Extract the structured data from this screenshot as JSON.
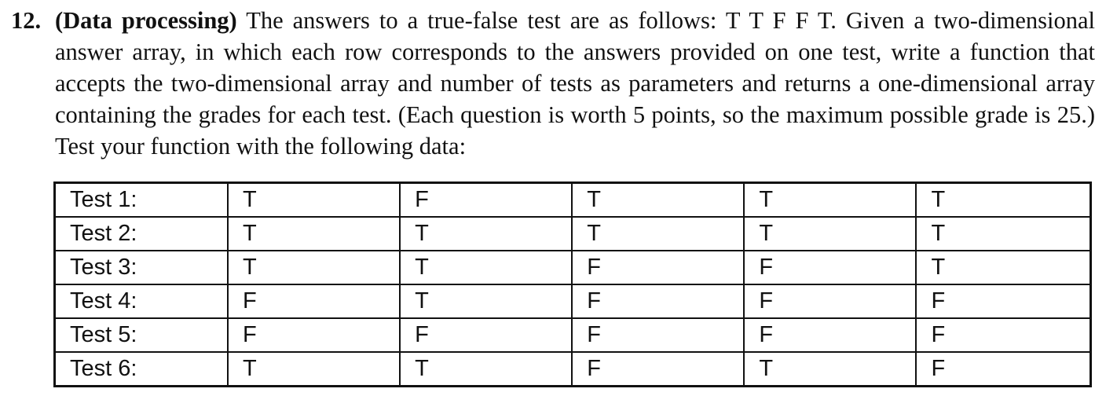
{
  "problem": {
    "number": "12.",
    "topic": "(Data processing)",
    "text": "The answers to a true-false test are as follows: T T F F T. Given a two-dimensional answer array, in which each row corresponds to the answers provided on one test, write a function that accepts the two-dimensional array and number of tests as parameters and returns a one-dimensional array containing the grades for each test. (Each question is worth 5 points, so the maximum possible grade is 25.) Test your function with the following data:"
  },
  "table": {
    "rows": [
      {
        "label": "Test 1:",
        "answers": [
          "T",
          "F",
          "T",
          "T",
          "T"
        ]
      },
      {
        "label": "Test 2:",
        "answers": [
          "T",
          "T",
          "T",
          "T",
          "T"
        ]
      },
      {
        "label": "Test 3:",
        "answers": [
          "T",
          "T",
          "F",
          "F",
          "T"
        ]
      },
      {
        "label": "Test 4:",
        "answers": [
          "F",
          "T",
          "F",
          "F",
          "F"
        ]
      },
      {
        "label": "Test 5:",
        "answers": [
          "F",
          "F",
          "F",
          "F",
          "F"
        ]
      },
      {
        "label": "Test 6:",
        "answers": [
          "T",
          "T",
          "F",
          "T",
          "F"
        ]
      }
    ]
  }
}
